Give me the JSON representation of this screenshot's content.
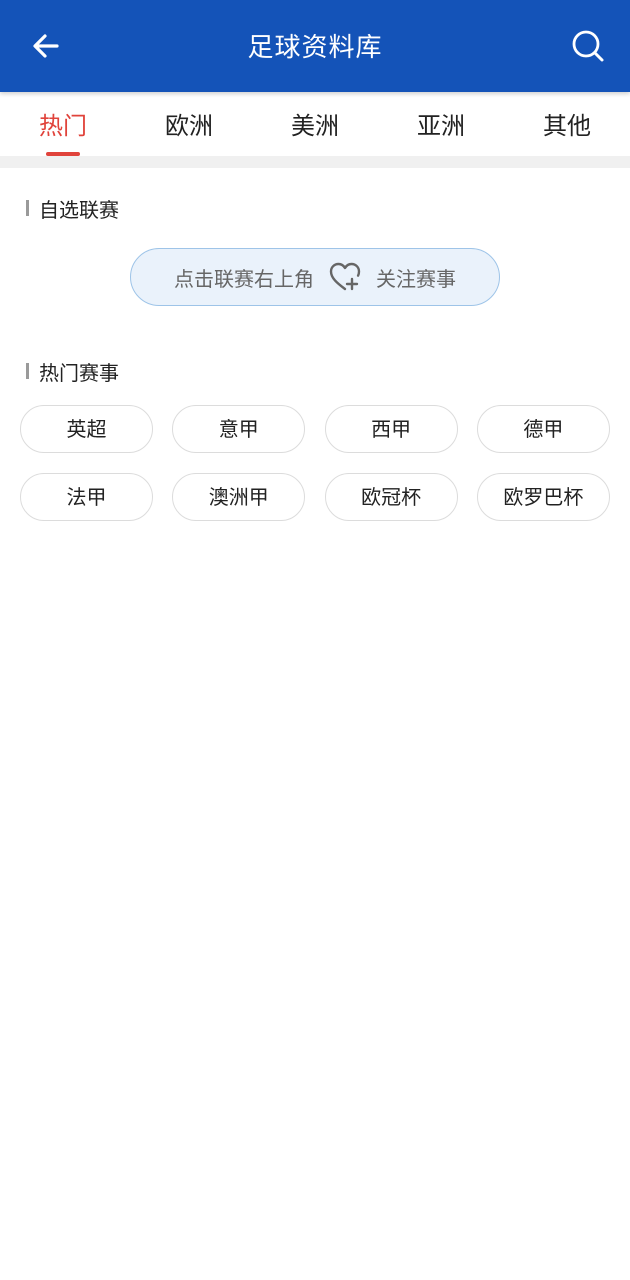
{
  "header": {
    "title": "足球资料库",
    "back_icon": "arrow-left-icon",
    "search_icon": "search-icon"
  },
  "tabs": [
    {
      "label": "热门",
      "active": true
    },
    {
      "label": "欧洲",
      "active": false
    },
    {
      "label": "美洲",
      "active": false
    },
    {
      "label": "亚洲",
      "active": false
    },
    {
      "label": "其他",
      "active": false
    }
  ],
  "favorites": {
    "title": "自选联赛",
    "hint_prefix": "点击联赛右上角",
    "hint_suffix": "关注赛事",
    "hint_icon": "heart-plus-icon"
  },
  "hot": {
    "title": "热门赛事",
    "leagues": [
      "英超",
      "意甲",
      "西甲",
      "德甲",
      "法甲",
      "澳洲甲",
      "欧冠杯",
      "欧罗巴杯"
    ]
  },
  "colors": {
    "header_bg": "#1453b8",
    "active_tab": "#e0433b",
    "pill_border": "#9ec4e8",
    "pill_bg": "#eaf2fb"
  }
}
